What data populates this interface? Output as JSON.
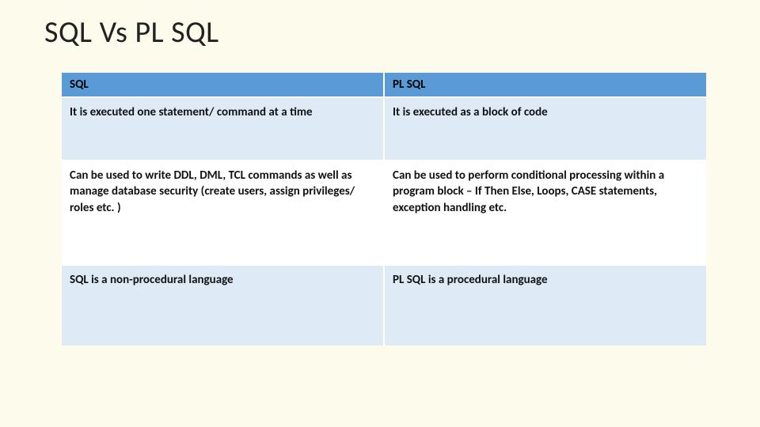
{
  "title": "SQL Vs PL SQL",
  "table": {
    "headers": [
      "SQL",
      "PL SQL"
    ],
    "rows": [
      {
        "sql": "It is executed one statement/ command at a time",
        "plsql": "It is executed as a block of code"
      },
      {
        "sql": "Can be used to write DDL, DML, TCL commands as well as manage database security (create users, assign privileges/ roles etc. )",
        "plsql": "Can be used to perform conditional processing within a program block – If Then Else, Loops, CASE statements, exception handling etc."
      },
      {
        "sql": "SQL is a non-procedural language",
        "plsql": "PL SQL is a procedural language"
      }
    ]
  }
}
